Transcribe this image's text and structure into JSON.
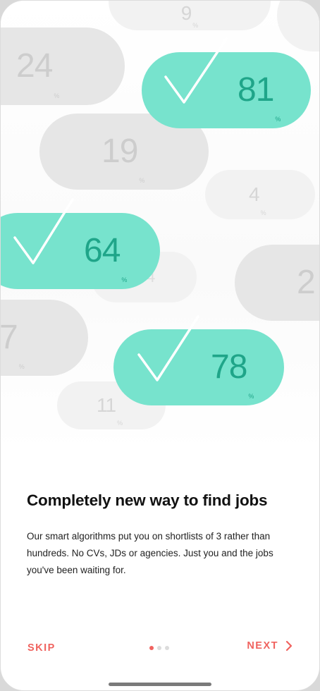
{
  "colors": {
    "accent": "#f0635f",
    "teal_pill": "#77e3cd",
    "teal_text": "#1fa589",
    "gray_pill": "#ececec",
    "gray_text": "#c9c9c9"
  },
  "hero": {
    "percent_sign": "%",
    "gray_pills": [
      {
        "value": "9"
      },
      {
        "value": "24"
      },
      {
        "value": "19"
      },
      {
        "value": "4"
      },
      {
        "value": "2"
      },
      {
        "value": "7"
      },
      {
        "value": "11"
      },
      {
        "value": "4"
      }
    ],
    "matched_pills": [
      {
        "value": "81",
        "icon": "checkmark-icon"
      },
      {
        "value": "64",
        "icon": "checkmark-icon"
      },
      {
        "value": "78",
        "icon": "checkmark-icon"
      }
    ]
  },
  "content": {
    "title": "Completely new way to find jobs",
    "description": "Our smart algorithms put you on shortlists of 3 rather than hundreds. No CVs, JDs or agencies. Just you and the jobs you've been waiting for."
  },
  "footer": {
    "skip_label": "SKIP",
    "next_label": "NEXT",
    "next_icon": "chevron-right-icon",
    "page_indicator": {
      "current": 1,
      "total": 3
    }
  }
}
